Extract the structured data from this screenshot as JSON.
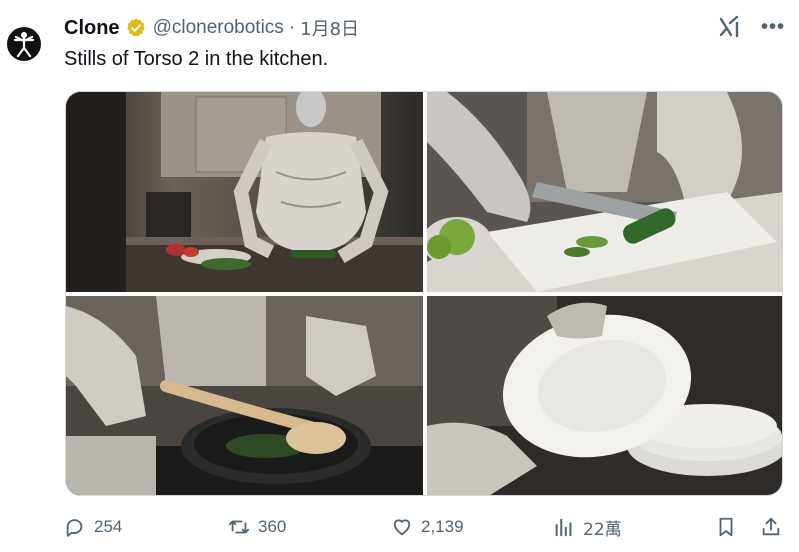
{
  "author": {
    "display_name": "Clone",
    "handle": "@clonerobotics",
    "separator": "·",
    "date": "1月8日"
  },
  "tweet": {
    "text": "Stills of Torso 2 in the kitchen."
  },
  "media": [
    {
      "subject": "robot-torso-kitchen"
    },
    {
      "subject": "cutting-cucumber"
    },
    {
      "subject": "stirring-pan"
    },
    {
      "subject": "holding-plate"
    }
  ],
  "actions": {
    "replies": "254",
    "reposts": "360",
    "likes": "2,139",
    "views": "22萬"
  },
  "icons": {
    "avatar": "vitruvian-figure-icon",
    "verified": "verified-badge-icon",
    "grok": "grok-icon",
    "more": "more-icon",
    "reply": "reply-icon",
    "repost": "repost-icon",
    "like": "heart-icon",
    "views": "views-icon",
    "bookmark": "bookmark-icon",
    "share": "share-icon"
  },
  "colors": {
    "text": "#0f1419",
    "secondary": "#536471",
    "verified_gold": "#e2b719"
  }
}
